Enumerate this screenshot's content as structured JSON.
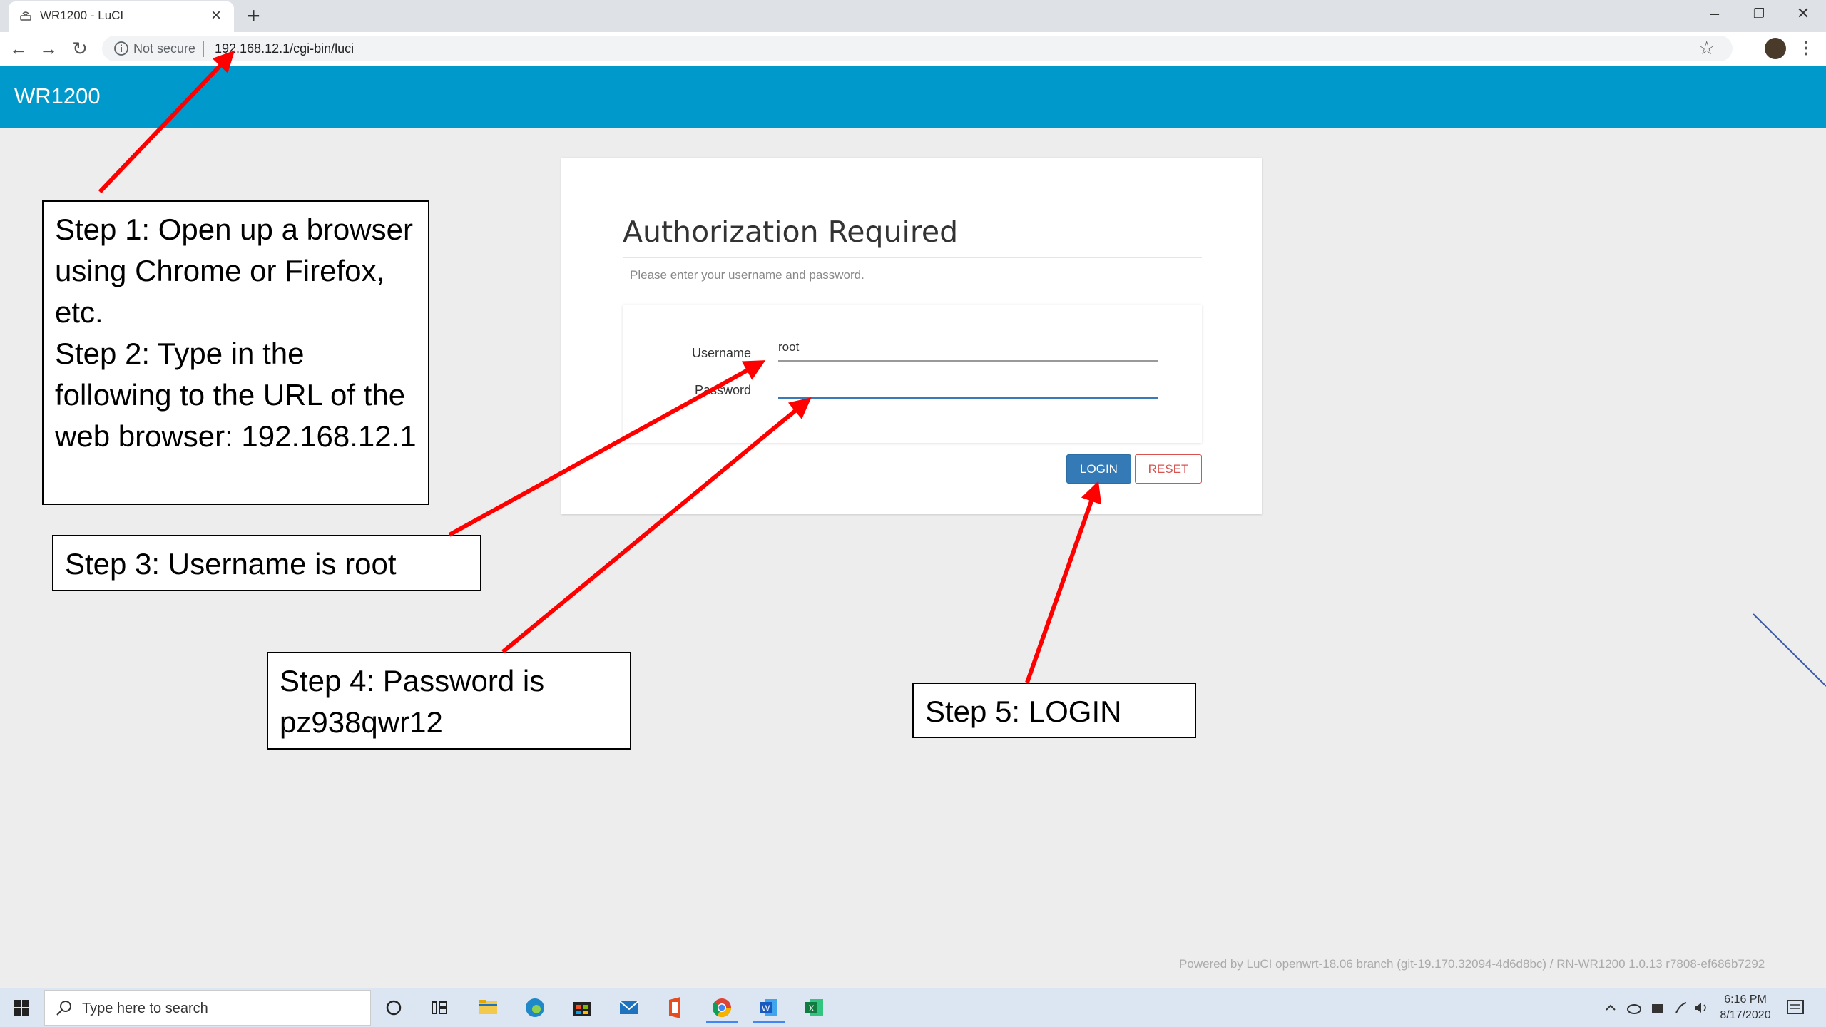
{
  "browser": {
    "tab_title": "WR1200 - LuCI",
    "tab_close": "×",
    "new_tab": "+",
    "not_secure": "Not secure",
    "url": "192.168.12.1/cgi-bin/luci",
    "window_controls": {
      "minimize": "–",
      "maximize": "❐",
      "close": "✕"
    },
    "nav": {
      "back": "←",
      "forward": "→",
      "reload": "↻"
    },
    "star": "☆",
    "menu": "⋮"
  },
  "luci": {
    "brand": "WR1200",
    "title": "Authorization Required",
    "description": "Please enter your username and password.",
    "username_label": "Username",
    "username_value": "root",
    "password_label": "Password",
    "password_value": "",
    "login_button": "LOGIN",
    "reset_button": "RESET",
    "footer": "Powered by LuCI openwrt-18.06 branch (git-19.170.32094-4d6d8bc) / RN-WR1200 1.0.13 r7808-ef686b7292"
  },
  "annotations": {
    "step1": "Step 1:  Open up a browser using Chrome or Firefox, etc.",
    "step2": "Step 2:  Type in the following to the URL of the web browser: 192.168.12.1",
    "step3": "Step 3:  Username is root",
    "step4": "Step 4:  Password is pz938qwr12",
    "step5": "Step 5:  LOGIN"
  },
  "taskbar": {
    "search_placeholder": "Type here to search",
    "time": "6:16 PM",
    "date": "8/17/2020",
    "icons": [
      "cortana-icon",
      "task-view-icon",
      "file-explorer-icon",
      "edge-icon",
      "store-icon",
      "mail-icon",
      "office-icon",
      "chrome-icon",
      "word-icon",
      "excel-icon"
    ]
  },
  "colors": {
    "header": "#0099cc",
    "login": "#337ab7",
    "reset": "#d9534f",
    "arrow": "#ff0000"
  }
}
